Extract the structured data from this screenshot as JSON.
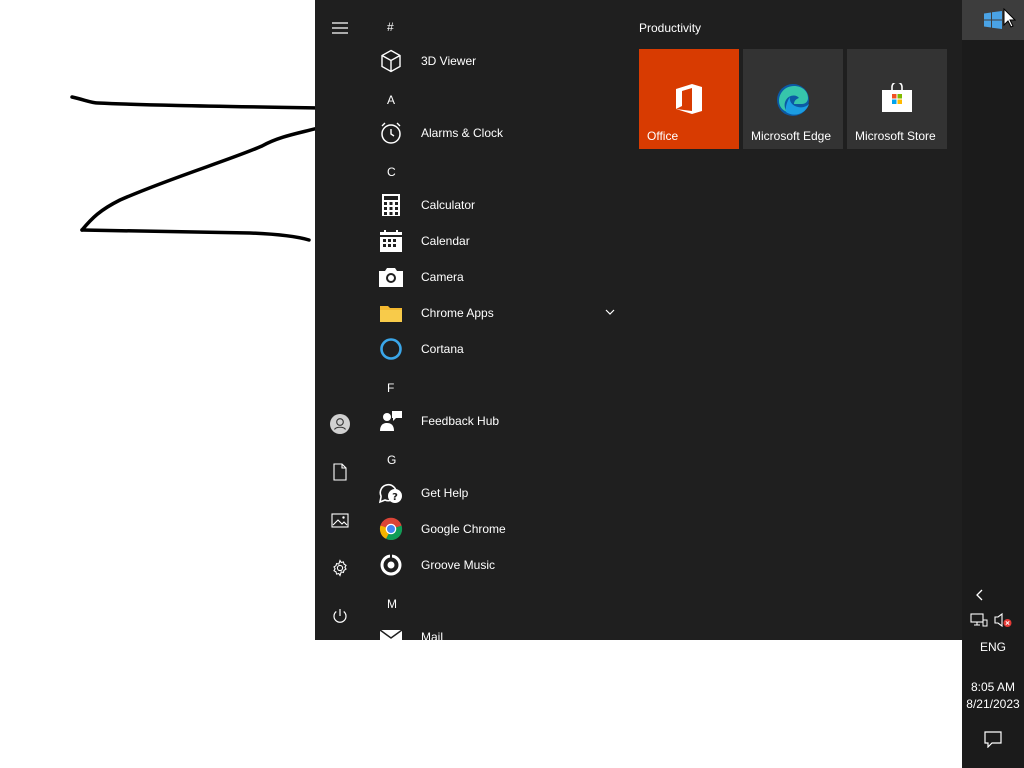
{
  "start_menu": {
    "groups": [
      {
        "letter": "#",
        "apps": [
          {
            "label": "3D Viewer",
            "icon": "cube-icon"
          }
        ]
      },
      {
        "letter": "A",
        "apps": [
          {
            "label": "Alarms & Clock",
            "icon": "alarm-clock-icon"
          }
        ]
      },
      {
        "letter": "C",
        "apps": [
          {
            "label": "Calculator",
            "icon": "calculator-icon"
          },
          {
            "label": "Calendar",
            "icon": "calendar-icon"
          },
          {
            "label": "Camera",
            "icon": "camera-icon"
          },
          {
            "label": "Chrome Apps",
            "icon": "folder-icon",
            "expandable": true
          },
          {
            "label": "Cortana",
            "icon": "cortana-icon"
          }
        ]
      },
      {
        "letter": "F",
        "apps": [
          {
            "label": "Feedback Hub",
            "icon": "feedback-hub-icon"
          }
        ]
      },
      {
        "letter": "G",
        "apps": [
          {
            "label": "Get Help",
            "icon": "get-help-icon"
          },
          {
            "label": "Google Chrome",
            "icon": "chrome-icon"
          },
          {
            "label": "Groove Music",
            "icon": "groove-music-icon"
          }
        ]
      },
      {
        "letter": "M",
        "apps": [
          {
            "label": "Mail",
            "icon": "mail-icon"
          }
        ]
      }
    ],
    "rail": [
      "hamburger-menu-icon",
      "user-account-icon",
      "documents-icon",
      "pictures-icon",
      "settings-icon",
      "power-icon"
    ],
    "tiles": {
      "group_title": "Productivity",
      "items": [
        {
          "label": "Office",
          "icon": "office-icon",
          "color": "#d83b01"
        },
        {
          "label": "Microsoft Edge",
          "icon": "edge-icon",
          "color": "#333333"
        },
        {
          "label": "Microsoft Store",
          "icon": "store-icon",
          "color": "#333333"
        }
      ]
    }
  },
  "taskbar": {
    "start_icon": "windows-logo-icon",
    "language": "ENG",
    "time": "8:05 AM",
    "date": "8/21/2023",
    "tray_icons": [
      "show-hidden-icons-chevron",
      "network-icon",
      "volume-muted-icon",
      "action-center-icon"
    ]
  },
  "colors": {
    "menu_bg": "#1f1f1f",
    "taskbar_bg": "#1b1b1b",
    "start_button_active": "#3d3d3d",
    "office_tile": "#d83b01",
    "tile_bg": "#333333"
  }
}
